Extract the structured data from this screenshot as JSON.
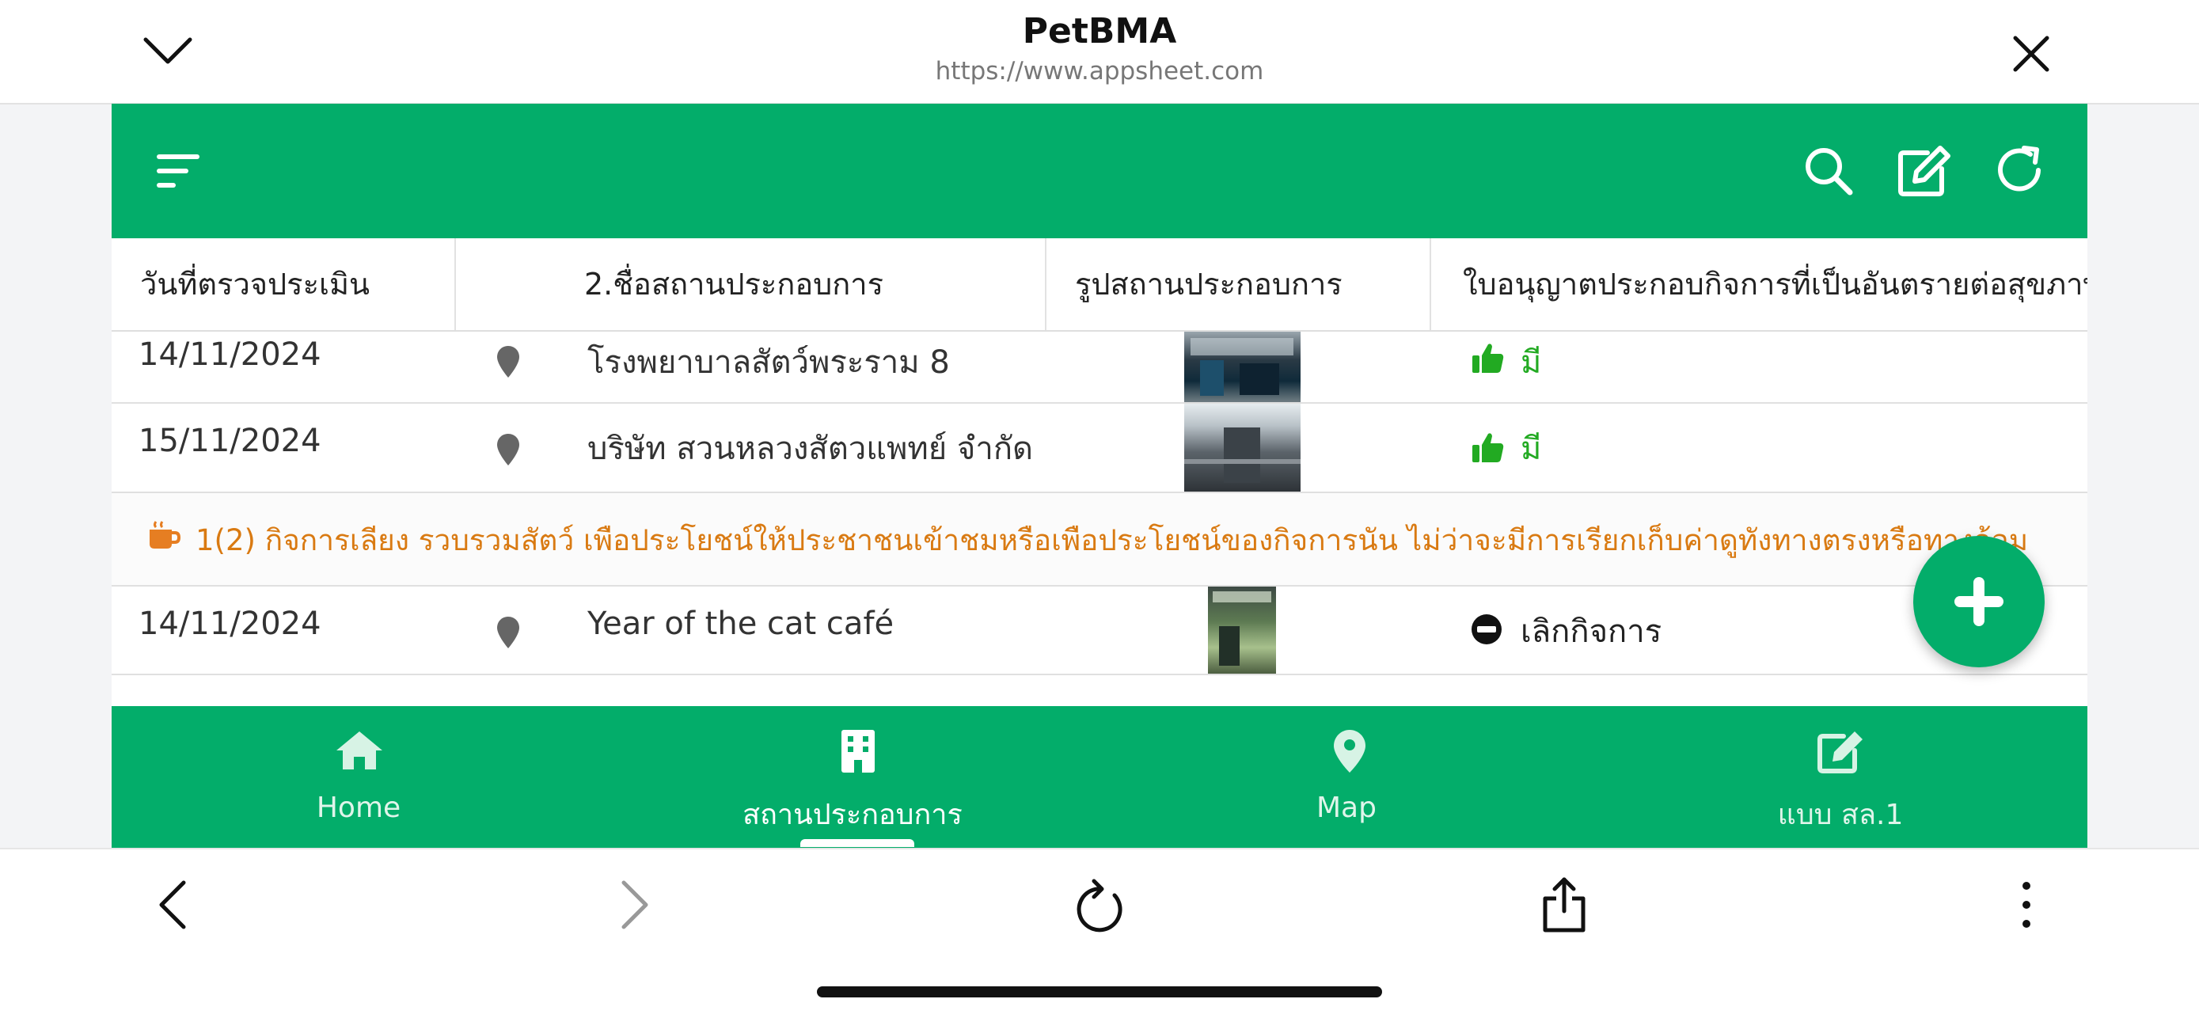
{
  "browser": {
    "title": "PetBMA",
    "url": "https://www.appsheet.com",
    "icons": {
      "collapse": "chevron-down-icon",
      "close": "close-icon"
    }
  },
  "app_header": {
    "icons": [
      "menu-icon",
      "search-icon",
      "edit-icon",
      "refresh-icon"
    ],
    "color": "#03ad6a"
  },
  "table": {
    "headers": [
      "วันที่ตรวจประเมิน",
      "2.ชื่อสถานประกอบการ",
      "รูปสถานประกอบการ",
      "ใบอนุญาตประกอบกิจการที่เป็นอันตรายต่อสุขภาพ"
    ],
    "rows_top": [
      {
        "date": "14/11/2024",
        "name": "โรงพยาบาลสัตว์พระราม 8",
        "license": "มี"
      },
      {
        "date": "15/11/2024",
        "name": "บริษัท สวนหลวงสัตวแพทย์ จำกัด",
        "license": "มี"
      }
    ],
    "group": {
      "label": "1(2) กิจการเลียง รวบรวมสัตว์ เพือประโยชน์ให้ประชาชนเข้าชมหรือเพือประโยชน์ของกิจการนัน ไม่ว่าจะมีการเรียกเก็บค่าดูทังทางตรงหรือทางอ้อม",
      "color": "#d97a12"
    },
    "rows_group": [
      {
        "date": "14/11/2024",
        "name": "Year of the cat café",
        "license": "เลิกกิจการ"
      }
    ]
  },
  "fab": {
    "icon": "plus-icon"
  },
  "bottom_nav": {
    "items": [
      {
        "label": "Home",
        "icon": "home-icon"
      },
      {
        "label": "สถานประกอบการ",
        "icon": "building-icon",
        "active": true
      },
      {
        "label": "Map",
        "icon": "map-pin-icon"
      },
      {
        "label": "แบบ สล.1",
        "icon": "edit-icon"
      }
    ]
  },
  "browser_toolbar": {
    "icons": [
      "back-icon",
      "forward-icon",
      "reload-icon",
      "share-icon",
      "more-icon"
    ]
  }
}
